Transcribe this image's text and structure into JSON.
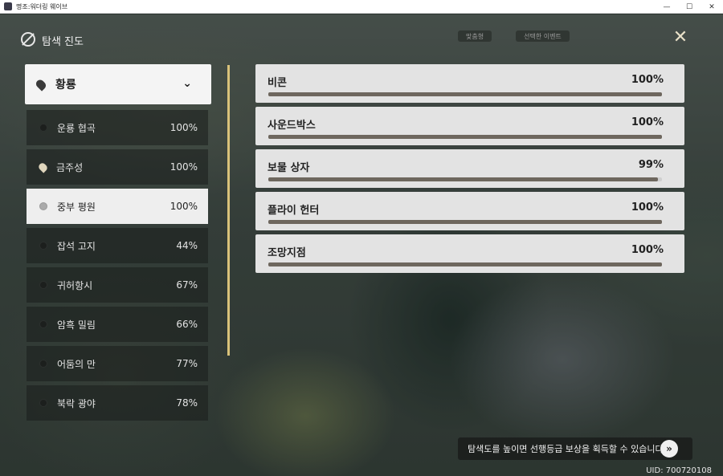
{
  "window": {
    "title": "명조:워더링 웨이브",
    "min": "—",
    "max": "☐",
    "close": "✕"
  },
  "header": {
    "title": "탐색 진도"
  },
  "top_widgets": [
    "맞춤형",
    "선택한 이벤트"
  ],
  "region": {
    "label": "황룡",
    "chevron": "⌄"
  },
  "subregions": [
    {
      "name": "운룡 협곡",
      "pct": "100%",
      "icon": "dot"
    },
    {
      "name": "금주성",
      "pct": "100%",
      "icon": "pin"
    },
    {
      "name": "중부 평원",
      "pct": "100%",
      "icon": "dot",
      "active": true
    },
    {
      "name": "잡석 고지",
      "pct": "44%",
      "icon": "dot"
    },
    {
      "name": "귀허항시",
      "pct": "67%",
      "icon": "dot"
    },
    {
      "name": "암흑 밀림",
      "pct": "66%",
      "icon": "dot"
    },
    {
      "name": "어둠의 만",
      "pct": "77%",
      "icon": "dot"
    },
    {
      "name": "북락 광야",
      "pct": "78%",
      "icon": "dot"
    }
  ],
  "categories": [
    {
      "name": "비콘",
      "pct": "100%",
      "progress": 1.0
    },
    {
      "name": "사운드박스",
      "pct": "100%",
      "progress": 1.0
    },
    {
      "name": "보물 상자",
      "pct": "99%",
      "progress": 0.99
    },
    {
      "name": "플라이 헌터",
      "pct": "100%",
      "progress": 1.0
    },
    {
      "name": "조망지점",
      "pct": "100%",
      "progress": 1.0
    }
  ],
  "hint": {
    "text": "탐색도를 높이면 선행등급 보상을 획득할 수 있습니다",
    "button": "»"
  },
  "uid": "UID: 700720108",
  "colors": {
    "accent_gold": "#d9c27a",
    "bar_fill": "#6e675e"
  }
}
